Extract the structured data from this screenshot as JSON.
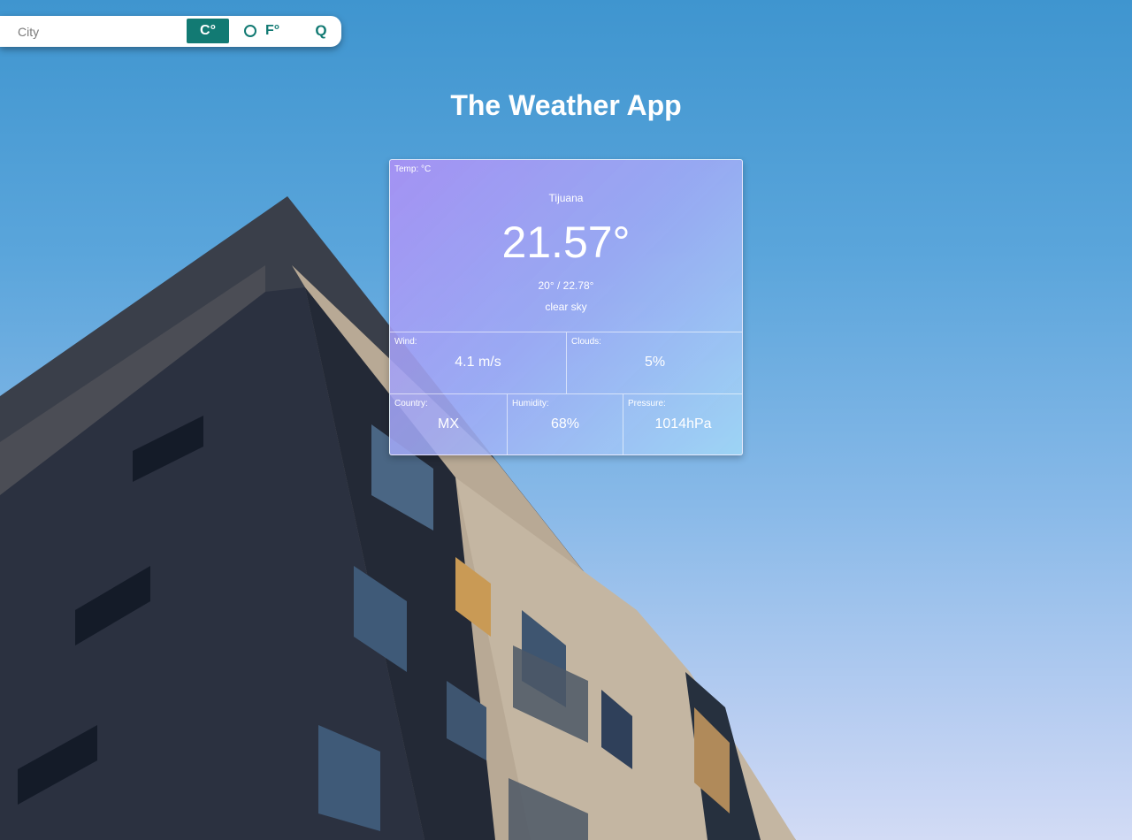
{
  "search": {
    "placeholder": "City",
    "celsius_label": "C°",
    "fahrenheit_label": "F°",
    "search_label": "Q"
  },
  "app": {
    "title": "The Weather App"
  },
  "weather": {
    "temp_unit_label": "Temp: °C",
    "city": "Tijuana",
    "temperature": "21.57°",
    "range": "20° / 22.78°",
    "description": "clear sky",
    "wind": {
      "label": "Wind:",
      "value": "4.1 m/s"
    },
    "clouds": {
      "label": "Clouds:",
      "value": "5%"
    },
    "country": {
      "label": "Country:",
      "value": "MX"
    },
    "humidity": {
      "label": "Humidity:",
      "value": "68%"
    },
    "pressure": {
      "label": "Pressure:",
      "value": "1014hPa"
    }
  },
  "colors": {
    "accent": "#127a73",
    "sky_top": "#3f95cf",
    "sky_bottom": "#d2dbf5"
  }
}
